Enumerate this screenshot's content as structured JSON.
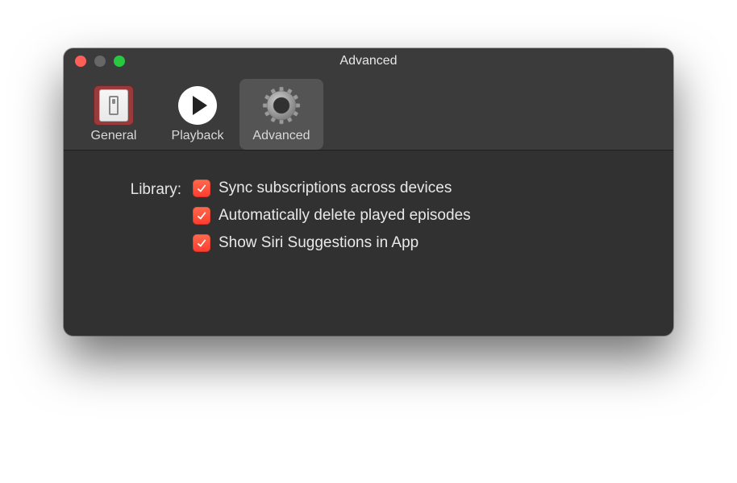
{
  "window_title": "Advanced",
  "tabs": {
    "general": {
      "label": "General"
    },
    "playback": {
      "label": "Playback"
    },
    "advanced": {
      "label": "Advanced",
      "selected": true
    }
  },
  "section": {
    "label": "Library:",
    "options": [
      {
        "label": "Sync subscriptions across devices",
        "checked": true
      },
      {
        "label": "Automatically delete played episodes",
        "checked": true
      },
      {
        "label": "Show Siri Suggestions in App",
        "checked": true
      }
    ]
  }
}
